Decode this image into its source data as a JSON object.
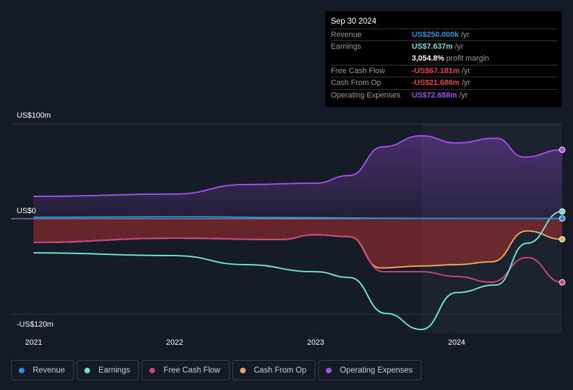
{
  "tooltip": {
    "date": "Sep 30 2024",
    "rows": [
      {
        "label": "Revenue",
        "value": "US$250.000k",
        "unit": " /yr",
        "color": "#2394df"
      },
      {
        "label": "Earnings",
        "value": "US$7.637m",
        "unit": " /yr",
        "color": "#6fe3d0"
      },
      {
        "label": "",
        "value": "3,054.8%",
        "unit": " profit margin",
        "color": "#ffffff"
      },
      {
        "label": "Free Cash Flow",
        "value": "-US$67.181m",
        "unit": " /yr",
        "color": "#e84040"
      },
      {
        "label": "Cash From Op",
        "value": "-US$21.686m",
        "unit": " /yr",
        "color": "#e84040"
      },
      {
        "label": "Operating Expenses",
        "value": "US$72.688m",
        "unit": " /yr",
        "color": "#a34ee8"
      }
    ]
  },
  "chart_data": {
    "type": "area",
    "y_tick_labels": [
      "US$100m",
      "US$0",
      "-US$120m"
    ],
    "y_ticks": [
      100,
      0,
      -120
    ],
    "x_tick_labels": [
      "2021",
      "2022",
      "2023",
      "2024"
    ],
    "x_ticks": [
      2021,
      2022,
      2023,
      2024
    ],
    "ylim": [
      -120,
      100
    ],
    "xlim": [
      2020.85,
      2024.75
    ],
    "legend_position": "bottom",
    "series": [
      {
        "name": "Revenue",
        "color": "#2394df",
        "x": [
          2021,
          2022,
          2023,
          2023.5,
          2024,
          2024.75
        ],
        "values": [
          1.5,
          2,
          1,
          0.5,
          0.3,
          0.25
        ]
      },
      {
        "name": "Earnings",
        "color": "#6fe3d0",
        "x": [
          2021,
          2022,
          2022.5,
          2023,
          2023.24,
          2023.5,
          2023.75,
          2024,
          2024.28,
          2024.5,
          2024.75
        ],
        "values": [
          -36,
          -39,
          -48.5,
          -56,
          -62,
          -100,
          -117,
          -78,
          -70,
          -26,
          7.6
        ]
      },
      {
        "name": "Free Cash Flow",
        "color": "#c9467e",
        "x": [
          2021,
          2022,
          2022.75,
          2023,
          2023.24,
          2023.48,
          2023.75,
          2024,
          2024.25,
          2024.5,
          2024.75
        ],
        "values": [
          -25,
          -20.6,
          -22,
          -17,
          -19,
          -56,
          -56,
          -61,
          -67,
          -41,
          -67.2
        ]
      },
      {
        "name": "Cash From Op",
        "color": "#e8a95a",
        "x": [
          2021,
          2022,
          2022.75,
          2023,
          2023.24,
          2023.46,
          2023.75,
          2024,
          2024.25,
          2024.5,
          2024.75
        ],
        "values": [
          -25,
          -20.6,
          -22,
          -17,
          -19,
          -52,
          -50,
          -48.5,
          -45.6,
          -13,
          -21.7
        ]
      },
      {
        "name": "Operating Expenses",
        "color": "#a34ee8",
        "x": [
          2021,
          2022,
          2022.5,
          2023,
          2023.24,
          2023.48,
          2023.75,
          2024,
          2024.28,
          2024.48,
          2024.75
        ],
        "values": [
          23.5,
          26,
          36,
          37.5,
          45.6,
          76,
          87.5,
          80,
          85,
          65,
          72.7
        ]
      }
    ]
  }
}
